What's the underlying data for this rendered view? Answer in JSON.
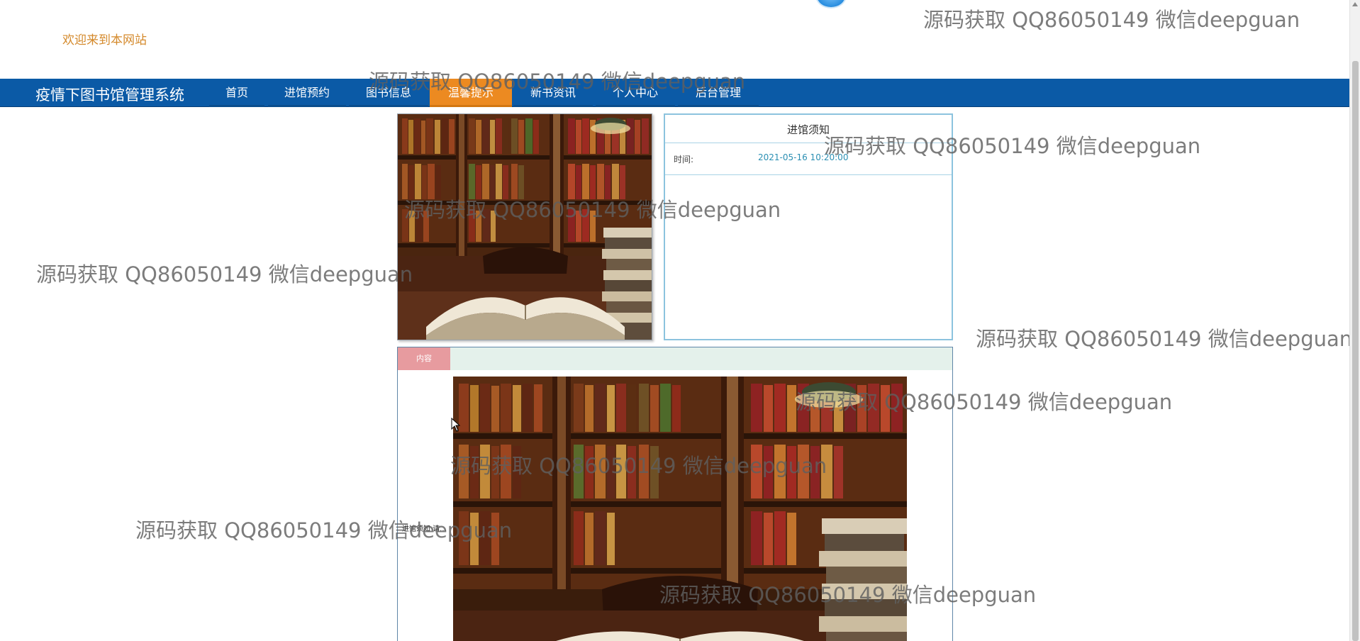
{
  "header": {
    "welcome": "欢迎来到本网站"
  },
  "nav": {
    "brand": "疫情下图书馆管理系统",
    "items": [
      {
        "label": "首页"
      },
      {
        "label": "进馆预约"
      },
      {
        "label": "图书信息"
      },
      {
        "label": "温馨提示",
        "active": true
      },
      {
        "label": "新书资讯"
      },
      {
        "label": "个人中心"
      },
      {
        "label": "后台管理"
      }
    ]
  },
  "notice": {
    "title": "进馆须知",
    "time_label": "时间:",
    "time_value": "2021-05-16 10:20:00"
  },
  "content": {
    "tab_label": "内容",
    "side_text": "进馆须知 请..."
  },
  "watermark": {
    "text": "源码获取 QQ86050149 微信deepguan"
  },
  "colors": {
    "nav_bg": "#0b5aa6",
    "nav_active": "#ec8a21",
    "welcome_text": "#d4892b",
    "tab_bg": "#e79b9f",
    "tabbar_bg": "#e4f1eb"
  }
}
